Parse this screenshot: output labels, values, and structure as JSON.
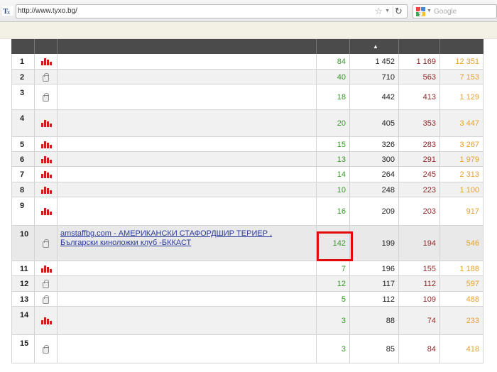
{
  "browser": {
    "url": "http://www.tyxo.bg/",
    "search_placeholder": "Google"
  },
  "table": {
    "sorted_column_indicator": "▲",
    "rows": [
      {
        "rank": "1",
        "icon": "bar-chart-icon",
        "site": "",
        "c1": "84",
        "c2": "1 452",
        "c3": "1 169",
        "c4": "12 351"
      },
      {
        "rank": "2",
        "icon": "lock-icon",
        "site": "",
        "c1": "40",
        "c2": "710",
        "c3": "563",
        "c4": "7 153"
      },
      {
        "rank": "3",
        "icon": "lock-icon",
        "site": "",
        "c1": "18",
        "c2": "442",
        "c3": "413",
        "c4": "1 129"
      },
      {
        "rank": "4",
        "icon": "bar-chart-icon",
        "site": "",
        "c1": "20",
        "c2": "405",
        "c3": "353",
        "c4": "3 447"
      },
      {
        "rank": "5",
        "icon": "bar-chart-icon",
        "site": "",
        "c1": "15",
        "c2": "326",
        "c3": "283",
        "c4": "3 267"
      },
      {
        "rank": "6",
        "icon": "bar-chart-icon",
        "site": "",
        "c1": "13",
        "c2": "300",
        "c3": "291",
        "c4": "1 979"
      },
      {
        "rank": "7",
        "icon": "bar-chart-icon",
        "site": "",
        "c1": "14",
        "c2": "264",
        "c3": "245",
        "c4": "2 313"
      },
      {
        "rank": "8",
        "icon": "bar-chart-icon",
        "site": "",
        "c1": "10",
        "c2": "248",
        "c3": "223",
        "c4": "1 100"
      },
      {
        "rank": "9",
        "icon": "bar-chart-icon",
        "site": "",
        "c1": "16",
        "c2": "209",
        "c3": "203",
        "c4": "917"
      },
      {
        "rank": "10",
        "icon": "lock-icon",
        "site_line1": "amstaffbg.com - АМЕРИКАНСКИ СТАФОРДШИР ТЕРИЕР ,",
        "site_line2": "Български киноложки клуб -БККАСТ",
        "c1": "142",
        "c2": "199",
        "c3": "194",
        "c4": "546"
      },
      {
        "rank": "11",
        "icon": "bar-chart-icon",
        "site": "",
        "c1": "7",
        "c2": "196",
        "c3": "155",
        "c4": "1 188"
      },
      {
        "rank": "12",
        "icon": "lock-icon",
        "site": "",
        "c1": "12",
        "c2": "117",
        "c3": "112",
        "c4": "597"
      },
      {
        "rank": "13",
        "icon": "lock-icon",
        "site": "",
        "c1": "5",
        "c2": "112",
        "c3": "109",
        "c4": "488"
      },
      {
        "rank": "14",
        "icon": "bar-chart-icon",
        "site": "",
        "c1": "3",
        "c2": "88",
        "c3": "74",
        "c4": "233"
      },
      {
        "rank": "15",
        "icon": "lock-icon",
        "site": "",
        "c1": "3",
        "c2": "85",
        "c3": "84",
        "c4": "418"
      }
    ]
  },
  "colors": {
    "header_bg": "#4b4b4b",
    "col1_green": "#3a9a2c",
    "col3_darkred": "#8f2a2a",
    "col4_orange": "#e3a12b",
    "highlight_box": "#e20a0a",
    "bar_icon_red": "#cc1c1c"
  }
}
